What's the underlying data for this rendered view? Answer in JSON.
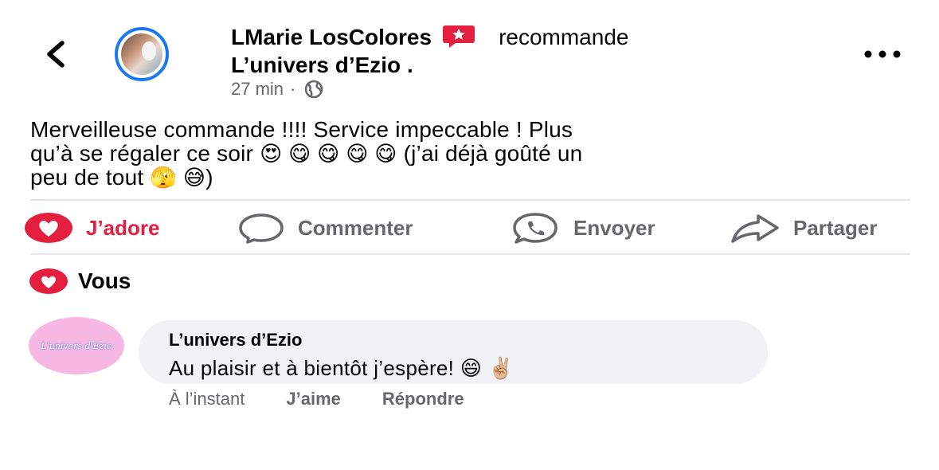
{
  "header": {
    "author": "LMarie LosColores",
    "verb": "recommande",
    "page": "L’univers d’Ezio .",
    "time": "27 min",
    "separator": "·"
  },
  "post": {
    "text_line1": "Merveilleuse commande !!!! Service impeccable ! Plus",
    "text_line2a": "qu’à se régaler ce soir",
    "text_line2_emojis": "😍 😋 😋 😋 😋",
    "text_line2b": "(j’ai déjà goûté un",
    "text_line3a": "peu de tout",
    "text_line3_emojis": "🫣 😅",
    "text_line3b": ")"
  },
  "actions": {
    "love": "J’adore",
    "comment": "Commenter",
    "send": "Envoyer",
    "share": "Partager"
  },
  "reactions": {
    "who": "Vous"
  },
  "comment": {
    "avatar_text": "L'univers d'Ezio",
    "author": "L’univers d’Ezio",
    "text": "Au plaisir et à bientôt j’espère!",
    "emojis": "😄 ✌🏼",
    "time": "À l’instant",
    "like": "J’aime",
    "reply": "Répondre"
  },
  "colors": {
    "accent_blue": "#1877f2",
    "love_red": "#e41e3f",
    "muted": "#65676b",
    "bubble_bg": "#f0f2f5",
    "avatar_pink": "#f6b8e3"
  }
}
